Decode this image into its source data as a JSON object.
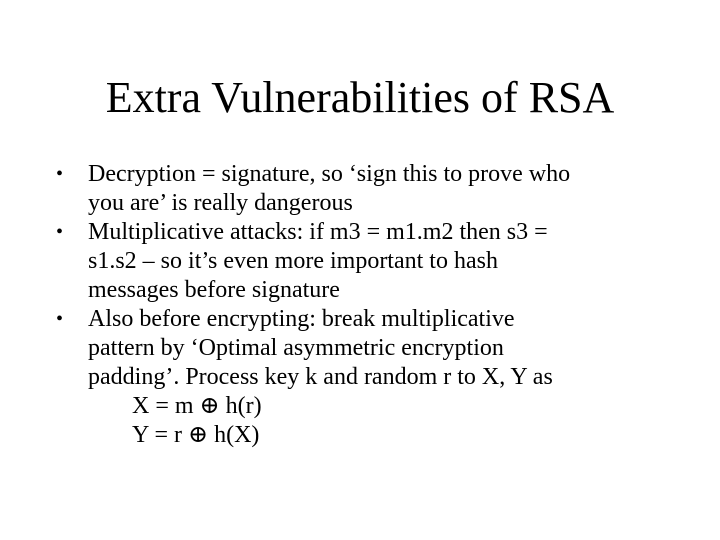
{
  "slide": {
    "title": "Extra Vulnerabilities of RSA",
    "bullets": [
      {
        "lines": [
          "Decryption = signature, so ‘sign this to prove who",
          "you are’ is really dangerous"
        ]
      },
      {
        "lines": [
          "Multiplicative attacks: if m3 = m1.m2 then s3 =",
          "s1.s2 – so it’s even more important to hash",
          "messages before signature"
        ]
      },
      {
        "lines": [
          "Also before encrypting: break multiplicative",
          "pattern by ‘Optimal asymmetric encryption",
          "padding’. Process key k and random r to X, Y as"
        ],
        "formulas": [
          "X = m ⊕ h(r)",
          "Y = r ⊕ h(X)"
        ]
      }
    ],
    "bullet_glyph": "•"
  }
}
